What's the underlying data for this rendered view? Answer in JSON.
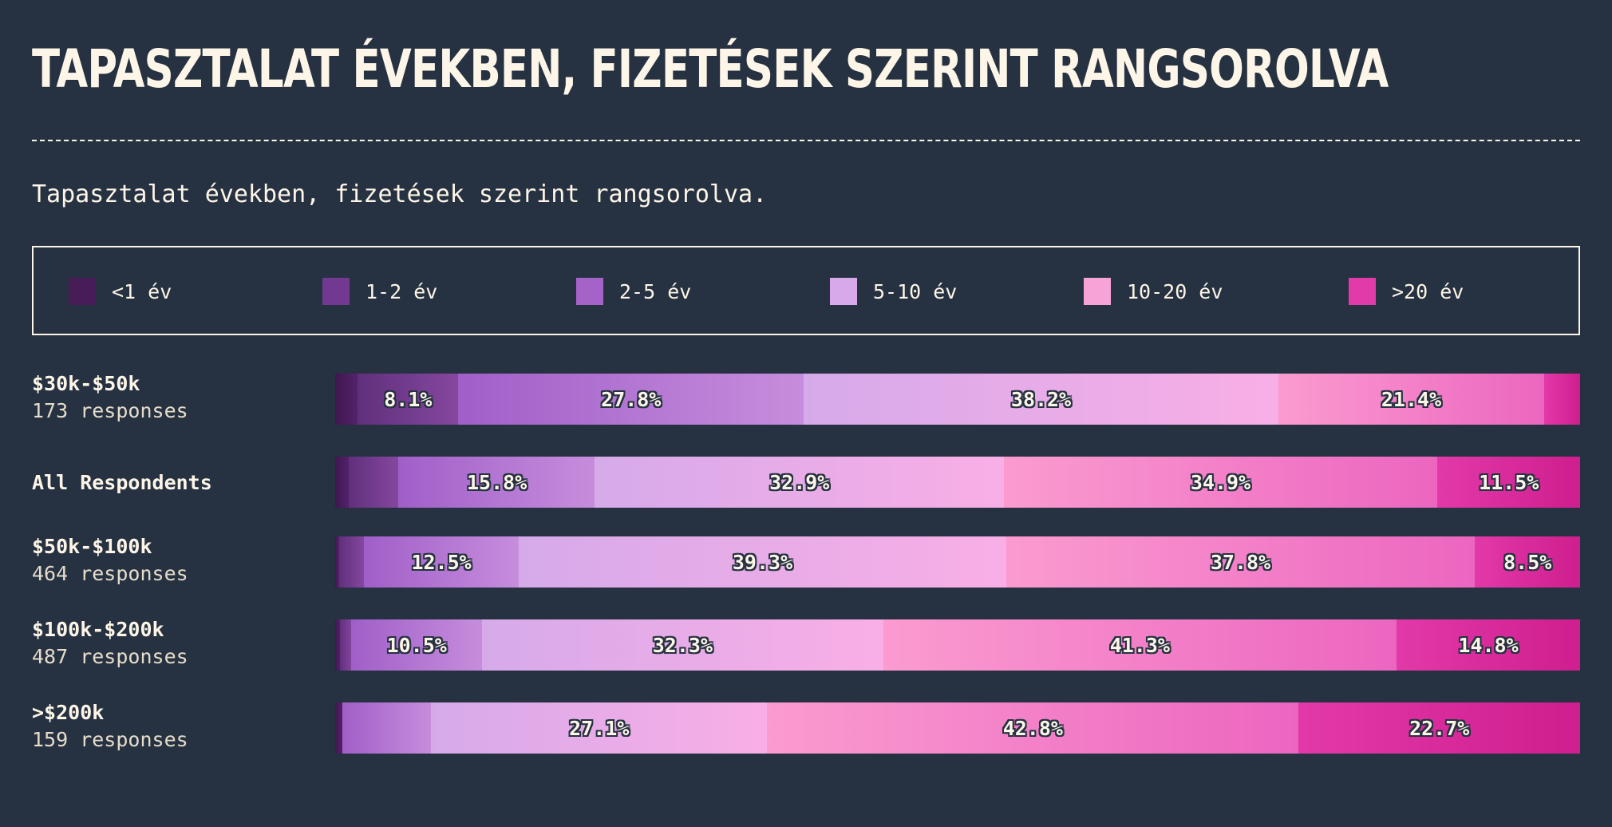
{
  "title": "TAPASZTALAT ÉVEKBEN, FIZETÉSEK SZERINT RANGSOROLVA",
  "subtitle": "Tapasztalat években, fizetések szerint rangsorolva.",
  "legend": [
    {
      "label": "<1 év",
      "color": "#471c57"
    },
    {
      "label": "1-2 év",
      "color": "#71398f"
    },
    {
      "label": "2-5 év",
      "color": "#a562c8"
    },
    {
      "label": "5-10 év",
      "color": "#d7a8ea"
    },
    {
      "label": "10-20 év",
      "color": "#f8a3d8"
    },
    {
      "label": ">20 év",
      "color": "#e13aa9"
    }
  ],
  "chart_data": {
    "type": "bar",
    "orientation": "horizontal",
    "stacked": true,
    "normalized": true,
    "categories": [
      "$30k-$50k",
      "All Respondents",
      "$50k-$100k",
      "$100k-$200k",
      ">$200k"
    ],
    "responses": [
      "173 responses",
      "",
      "464 responses",
      "487 responses",
      "159 responses"
    ],
    "series": [
      {
        "name": "<1 év",
        "values": [
          1.8,
          1.1,
          0.3,
          0.4,
          0.6
        ]
      },
      {
        "name": "1-2 év",
        "values": [
          8.1,
          4.0,
          2.0,
          0.9,
          0.0
        ]
      },
      {
        "name": "2-5 év",
        "values": [
          27.8,
          15.8,
          12.5,
          10.5,
          7.1
        ]
      },
      {
        "name": "5-10 év",
        "values": [
          38.2,
          32.9,
          39.3,
          32.3,
          27.1
        ]
      },
      {
        "name": "10-20 év",
        "values": [
          21.4,
          34.9,
          37.8,
          41.3,
          42.8
        ]
      },
      {
        "name": ">20 év",
        "values": [
          2.9,
          11.5,
          8.5,
          14.8,
          22.7
        ]
      }
    ],
    "labels": [
      [
        "",
        "8.1%",
        "27.8%",
        "38.2%",
        "21.4%",
        ""
      ],
      [
        "",
        "",
        "15.8%",
        "32.9%",
        "34.9%",
        "11.5%"
      ],
      [
        "",
        "",
        "12.5%",
        "39.3%",
        "37.8%",
        "8.5%"
      ],
      [
        "",
        "",
        "10.5%",
        "32.3%",
        "41.3%",
        "14.8%"
      ],
      [
        "",
        "",
        "",
        "27.1%",
        "42.8%",
        "22.7%"
      ]
    ],
    "xlim": [
      0,
      100
    ]
  }
}
